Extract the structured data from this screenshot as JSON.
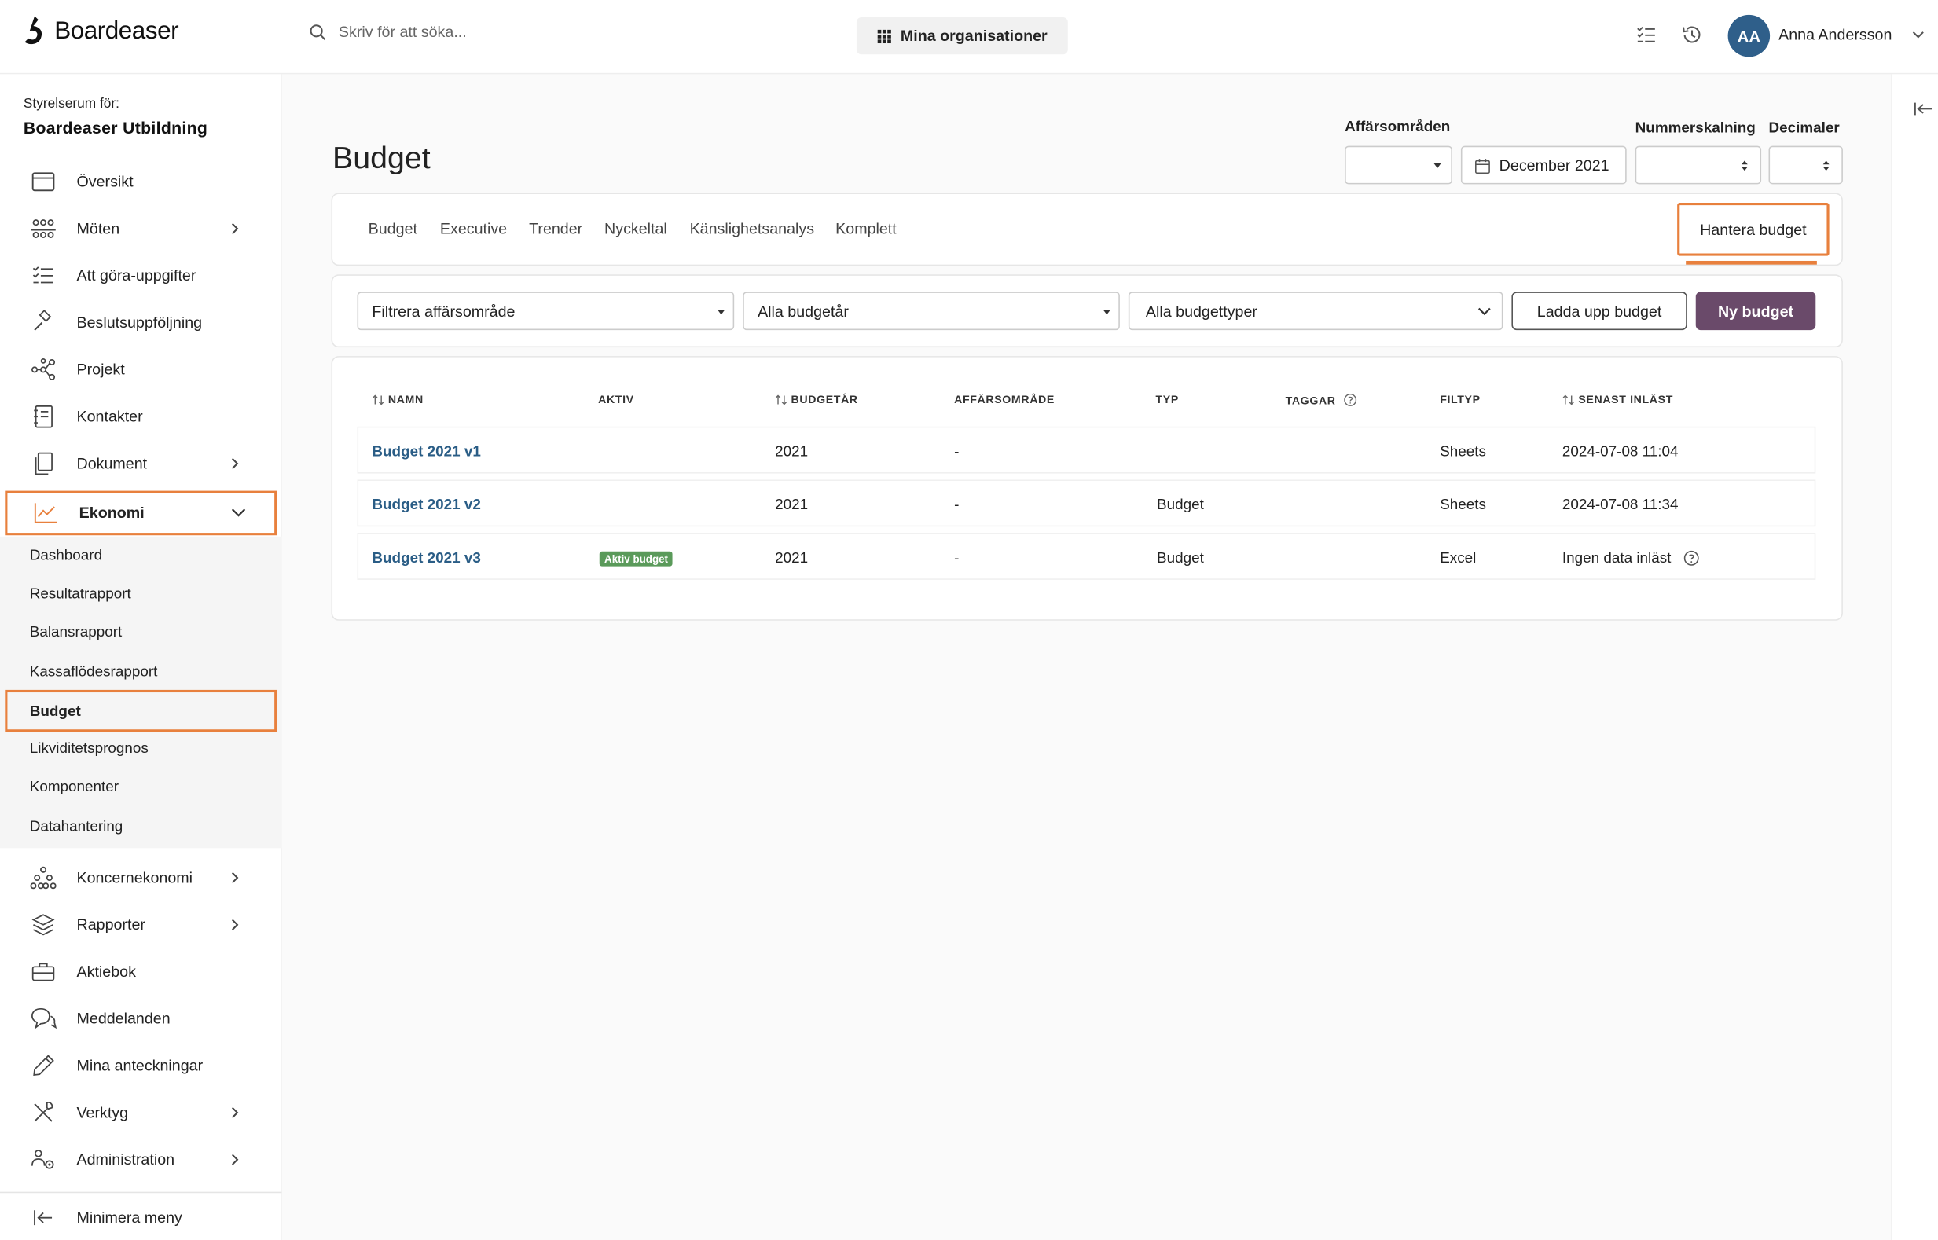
{
  "app": {
    "name": "Boardeaser"
  },
  "search": {
    "placeholder": "Skriv för att söka..."
  },
  "header": {
    "org_button": "Mina organisationer",
    "user_initials": "AA",
    "user_name": "Anna Andersson"
  },
  "sidebar": {
    "room_label": "Styrelserum för:",
    "room_name": "Boardeaser Utbildning",
    "items": [
      {
        "label": "Översikt",
        "icon": "calendar-icon"
      },
      {
        "label": "Möten",
        "icon": "meeting-icon"
      },
      {
        "label": "Att göra-uppgifter",
        "icon": "checklist-icon"
      },
      {
        "label": "Beslutsuppföljning",
        "icon": "gavel-icon"
      },
      {
        "label": "Projekt",
        "icon": "network-icon"
      },
      {
        "label": "Kontakter",
        "icon": "contacts-icon"
      },
      {
        "label": "Dokument",
        "icon": "document-icon"
      },
      {
        "label": "Ekonomi",
        "icon": "chart-icon"
      },
      {
        "label": "Koncernekonomi",
        "icon": "hierarchy-icon"
      },
      {
        "label": "Rapporter",
        "icon": "layers-icon"
      },
      {
        "label": "Aktiebok",
        "icon": "briefcase-icon"
      },
      {
        "label": "Meddelanden",
        "icon": "chat-icon"
      },
      {
        "label": "Mina anteckningar",
        "icon": "pencil-icon"
      },
      {
        "label": "Verktyg",
        "icon": "tools-icon"
      },
      {
        "label": "Administration",
        "icon": "admin-icon"
      }
    ],
    "sub_items": [
      "Dashboard",
      "Resultatrapport",
      "Balansrapport",
      "Kassaflödesrapport",
      "Budget",
      "Likviditetsprognos",
      "Komponenter",
      "Datahantering"
    ],
    "minimize": "Minimera meny"
  },
  "main": {
    "title": "Budget",
    "controls": {
      "business_areas_label": "Affärsområden",
      "date_value": "December 2021",
      "scaling_label": "Nummerskalning",
      "decimals_label": "Decimaler"
    },
    "tabs": [
      "Budget",
      "Executive",
      "Trender",
      "Nyckeltal",
      "Känslighetsanalys",
      "Komplett"
    ],
    "manage_tab": "Hantera budget",
    "filters": {
      "area": "Filtrera affärsområde",
      "year": "Alla budgetår",
      "type": "Alla budgettyper"
    },
    "buttons": {
      "upload": "Ladda upp budget",
      "new": "Ny budget"
    },
    "table": {
      "headers": [
        "NAMN",
        "AKTIV",
        "BUDGETÅR",
        "AFFÄRSOMRÅDE",
        "TYP",
        "TAGGAR",
        "FILTYP",
        "SENAST INLÄST"
      ],
      "rows": [
        {
          "name": "Budget 2021 v1",
          "active": "",
          "year": "2021",
          "area": "-",
          "type": "",
          "filetype": "Sheets",
          "loaded": "2024-07-08 11:04"
        },
        {
          "name": "Budget 2021 v2",
          "active": "",
          "year": "2021",
          "area": "-",
          "type": "Budget",
          "filetype": "Sheets",
          "loaded": "2024-07-08 11:34"
        },
        {
          "name": "Budget 2021 v3",
          "active": "Aktiv budget",
          "year": "2021",
          "area": "-",
          "type": "Budget",
          "filetype": "Excel",
          "loaded": "Ingen data inläst"
        }
      ]
    }
  },
  "colors": {
    "accent": "#e8803d",
    "primary": "#6a4a6a",
    "link": "#2a5d86",
    "badge": "#5a9a5a",
    "avatar": "#2f5f8a"
  }
}
